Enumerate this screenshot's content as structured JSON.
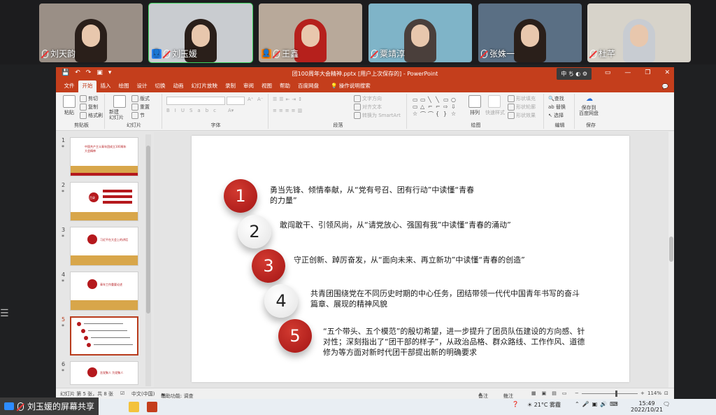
{
  "meeting": {
    "participants": [
      {
        "name": "刘天韵",
        "active": false,
        "host": false,
        "bg": "#9a8f86"
      },
      {
        "name": "刘玉媛",
        "active": true,
        "host": true,
        "host_color": "#2d8cff",
        "bg": "#c9ccd0"
      },
      {
        "name": "王鑫",
        "active": false,
        "host": true,
        "host_color": "#ff8c1a",
        "bg": "#b8a99a"
      },
      {
        "name": "粟靖淳",
        "active": false,
        "host": false,
        "bg": "#7fb4c8"
      },
      {
        "name": "张姝一",
        "active": false,
        "host": false,
        "bg": "#5a6f84"
      },
      {
        "name": "杜芊",
        "active": false,
        "host": false,
        "bg": "#d7d3ca"
      }
    ],
    "share_label": "刘玉媛的屏幕共享"
  },
  "ppt": {
    "window_title": "团100周年大会精神.pptx [用户上次保存的] - PowerPoint",
    "ime_label": "中 ち ◐ ⚙",
    "tabs": [
      "文件",
      "开始",
      "插入",
      "绘图",
      "设计",
      "切换",
      "动画",
      "幻灯片放映",
      "录制",
      "审阅",
      "视图",
      "帮助",
      "百度网盘"
    ],
    "active_tab": "开始",
    "search_tab": "操作说明搜索",
    "ribbon": {
      "clipboard": {
        "label": "剪贴板",
        "paste": "粘贴",
        "cut": "剪切",
        "copy": "复制",
        "format_painter": "格式刷"
      },
      "slides": {
        "label": "幻灯片",
        "new_slide": "新建\n幻灯片",
        "layout": "版式",
        "reset": "重置",
        "section": "节"
      },
      "font": {
        "label": "字体"
      },
      "paragraph": {
        "label": "段落",
        "text_direction": "文字方向",
        "align_text": "对齐文本",
        "smartart": "转换为 SmartArt"
      },
      "drawing": {
        "label": "绘图",
        "arrange": "排列",
        "quick_styles": "快速样式",
        "fill": "形状填充",
        "outline": "形状轮廓",
        "effects": "形状效果"
      },
      "editing": {
        "label": "编辑",
        "find": "查找",
        "replace": "替换",
        "select": "选择"
      },
      "save": {
        "label": "保存",
        "save_to": "保存到\n百度网盘"
      }
    },
    "thumbnails": [
      {
        "num": "1",
        "text": "中国共产主义青年团成立100周年大会精神"
      },
      {
        "num": "2",
        "text": "目录"
      },
      {
        "num": "3",
        "text": "习近平在大会上的讲话"
      },
      {
        "num": "4",
        "text": "青年工作重要论述"
      },
      {
        "num": "5",
        "text": "",
        "selected": true
      },
      {
        "num": "6",
        "text": "含党聚人 为党聚人"
      }
    ],
    "slide": {
      "points": [
        {
          "number": "1",
          "style": "red",
          "text": "勇当先锋、倾情奉献，从“党有号召、团有行动”中读懂“青春的力量”"
        },
        {
          "number": "2",
          "style": "white",
          "text": "敢闯敢干、引领风尚，从“请党放心、强国有我”中读懂“青春的涌动”"
        },
        {
          "number": "3",
          "style": "red",
          "text": "守正创新、踔厉奋发，从“面向未来、再立新功”中读懂“青春的创造”"
        },
        {
          "number": "4",
          "style": "white",
          "text": "共青团围绕党在不同历史时期的中心任务，团结带领一代代中国青年书写的奋斗篇章、展现的精神风貌"
        },
        {
          "number": "5",
          "style": "red",
          "text": "“五个带头、五个模范”的殷切希望，进一步提升了团员队伍建设的方向感、针对性；深刻指出了“团干部的样子”，从政治品格、群众路线、工作作风、道德修为等方面对新时代团干部提出新的明确要求"
        }
      ]
    },
    "status": {
      "slide_count": "幻灯片 第 5 张，共 8 张",
      "language": "中文(中国)",
      "accessibility": "辅助功能: 调查",
      "notes": "备注",
      "comments": "批注",
      "zoom": "114%"
    }
  },
  "taskbar": {
    "weather": "21°C 雾霾",
    "time": "15:49",
    "date": "2022/10/21"
  }
}
